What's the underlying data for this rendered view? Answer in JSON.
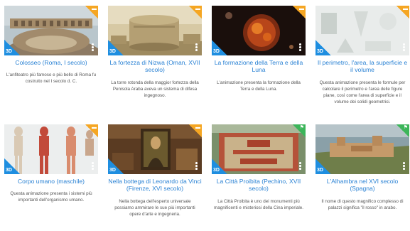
{
  "cards": [
    {
      "title": "Colosseo (Roma, I secolo)",
      "description": "L'anfiteatro più famoso e più bello di Roma fu costruito nel I secolo d. C.",
      "badge": "3D",
      "corner_icon": "box-icon",
      "corner_color": "#f5a623"
    },
    {
      "title": "La fortezza di Nizwa (Oman, XVII secolo)",
      "description": "La torre rotonda della maggior fortezza della Penisola Araba aveva un sistema di difesa ingegnoso.",
      "badge": "3D",
      "corner_icon": "box-icon",
      "corner_color": "#f5a623"
    },
    {
      "title": "La formazione della Terra e della Luna",
      "description": "L'animazione presenta la formazione della Terra e della Luna.",
      "badge": "3D",
      "corner_icon": "box-icon",
      "corner_color": "#f5a623"
    },
    {
      "title": "Il perimetro, l'area, la superficie e il volume",
      "description": "Questa animazione presenta le formule per calcolare il perimetro e l'area delle figure piane, così come l'area di superficie e il volume dei solidi geometrici.",
      "badge": "3D",
      "corner_icon": "box-icon",
      "corner_color": "#f5a623"
    },
    {
      "title": "Corpo umano (maschile)",
      "description": "Questa animazione presenta i sistemi più importanti dell'organismo umano.",
      "badge": "3D",
      "corner_icon": "box-icon",
      "corner_color": "#f5a623"
    },
    {
      "title": "Nella bottega di Leonardo da Vinci (Firenze, XVI secolo)",
      "description": "Nella bottega dell'esperto universale possiamo ammirare le sue più importanti opere d'arte e ingegneria.",
      "badge": "3D",
      "corner_icon": "box-icon",
      "corner_color": "#f5a623"
    },
    {
      "title": "La Città Proibita (Pechino, XVII secolo)",
      "description": "La Città Proibita è uno dei monumenti più magnificenti e misteriosi della Cina imperiale.",
      "badge": "3D",
      "corner_icon": "flag-icon",
      "corner_color": "#3cb55a"
    },
    {
      "title": "L'Alhambra nel XVI secolo (Spagna)",
      "description": "Il nome di questo magnifico complesso di palazzi significa \"il rosso\" in arabo.",
      "badge": "3D",
      "corner_icon": "flag-icon",
      "corner_color": "#3cb55a"
    }
  ]
}
